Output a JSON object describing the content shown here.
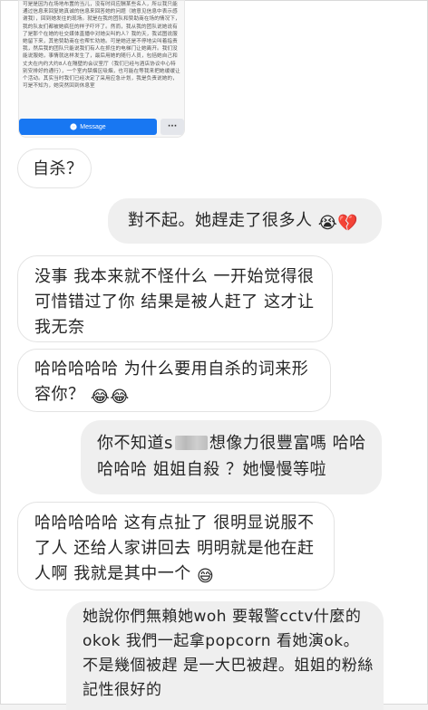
{
  "quoted_post": {
    "text": "可是是因为在场地布置的当儿，没有时间应酬某些名人，所以我只能通过信息来回复她真诚的信息来回答她的问题（她意见信息中表示感谢我），回到她发往的现场。就是在我的团队和赞助商在场的情况下，我的队友们都被她疯狂的样子吓坏了。然而，我从我的团队说她说有了是那个在她的社交媒体直播中对她尖叫的人？我的天，我试图说服她留下来，其他赞助商在也帮忙劝她。可是她还是不停地尖叫着指责我，然后我的团队只能说我们有人在抓住的电梯门让她离开。我们没能说服她，事情就这样发生了，最后用她的随行人员，包括她自己和丈夫在内约大约8人在隔壁的会议室厅（我们已经与酒店协议中心特别安排好的通行），一个室内禁烟区吸烟，也可能在等我来把她缓缓让个活动。其实当时我们已经决定了采用应急计划，我是负责说她的，可是不知为，她突然回到休息室",
    "message_label": "Message",
    "more_label": "···"
  },
  "messages": [
    {
      "side": "left",
      "text": "自杀？"
    },
    {
      "side": "right",
      "text": "對不起。她趕走了很多人",
      "emoji": "😭💔"
    },
    {
      "side": "left",
      "text": "没事 我本来就不怪什么 一开始觉得很可惜错过了你 结果是被人赶了 这才让我无奈"
    },
    {
      "side": "left",
      "text": "哈哈哈哈哈 为什么要用自杀的词来形容你？",
      "emoji": "😂😂"
    },
    {
      "side": "right",
      "text_before": "你不知道s",
      "text_after": "想像力很豐富嗎 哈哈哈哈哈 姐姐自殺 ？她慢慢等啦"
    },
    {
      "side": "left",
      "text": "哈哈哈哈哈 这有点扯了 很明显说服不了人 还给人家讲回去 明明就是他在赶人啊 我就是其中一个",
      "emoji": "😅"
    },
    {
      "side": "right",
      "text": "她說你們無賴她woh 要報警cctv什麼的 okok 我們一起拿popcorn 看她演ok。不是幾個被趕 是一大巴被趕。姐姐的粉絲記性很好的"
    }
  ]
}
